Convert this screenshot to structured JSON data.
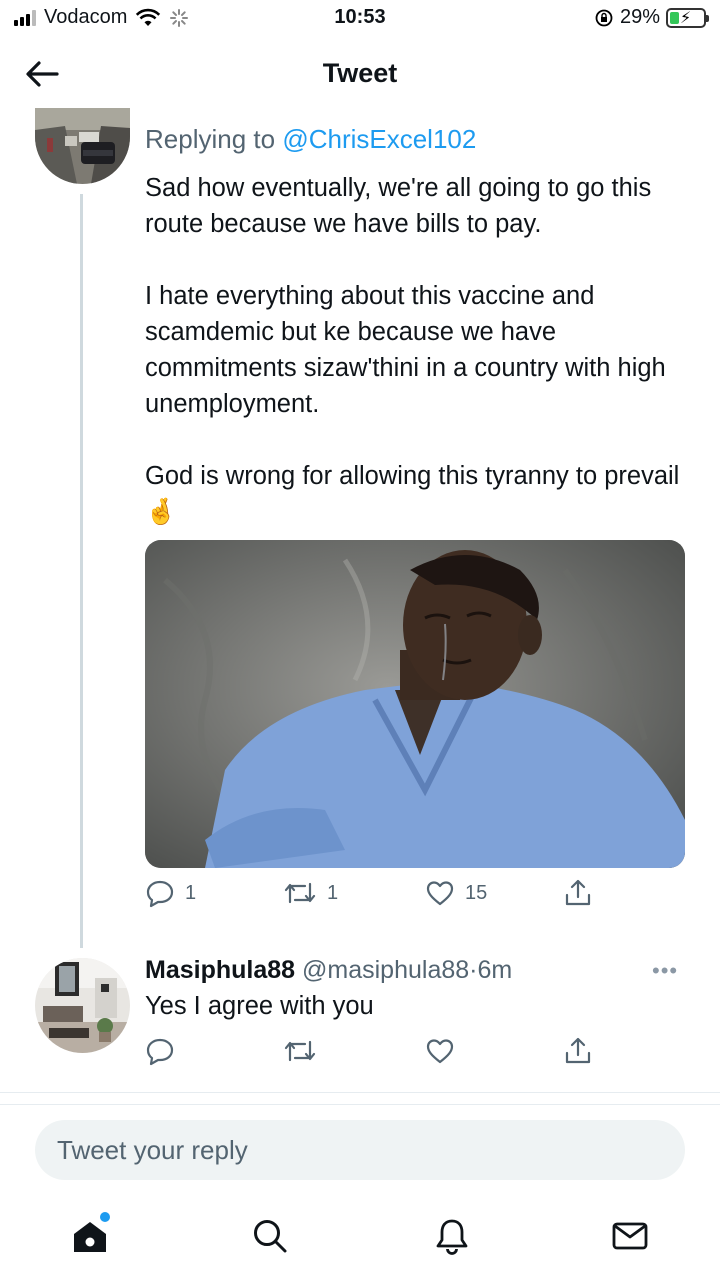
{
  "status_bar": {
    "carrier": "Vodacom",
    "time": "10:53",
    "battery_percent": "29%",
    "battery_level": 0.29,
    "icons": [
      "signal-icon",
      "wifi-icon",
      "loading-icon",
      "orientation-lock-icon",
      "battery-charging-icon"
    ]
  },
  "header": {
    "title": "Tweet",
    "back_icon": "back-arrow-icon"
  },
  "main_tweet": {
    "replying_prefix": "Replying to ",
    "replying_handle": "@ChrisExcel102",
    "paragraphs": [
      "Sad how eventually, we're all going to go this route because we have bills to pay.",
      "I hate everything about this vaccine and scamdemic but ke because we have commitments sizaw'thini in a country with high unemployment.",
      "God is wrong for allowing this tyranny to prevail"
    ],
    "emoji": "🤞",
    "actions": {
      "replies": "1",
      "retweets": "1",
      "likes": "15"
    }
  },
  "reply_tweet": {
    "name": "Masiphula88",
    "handle": "@masiphula88",
    "separator": "·",
    "time": "6m",
    "text": "Yes I agree with you",
    "more": "•••"
  },
  "composer": {
    "placeholder": "Tweet your reply"
  },
  "tabbar": {
    "items": [
      "home-icon",
      "search-icon",
      "notifications-icon",
      "messages-icon"
    ]
  },
  "colors": {
    "accent": "#1d9bf0",
    "text": "#0f1419",
    "secondary": "#536471",
    "line": "#cfd9de"
  }
}
